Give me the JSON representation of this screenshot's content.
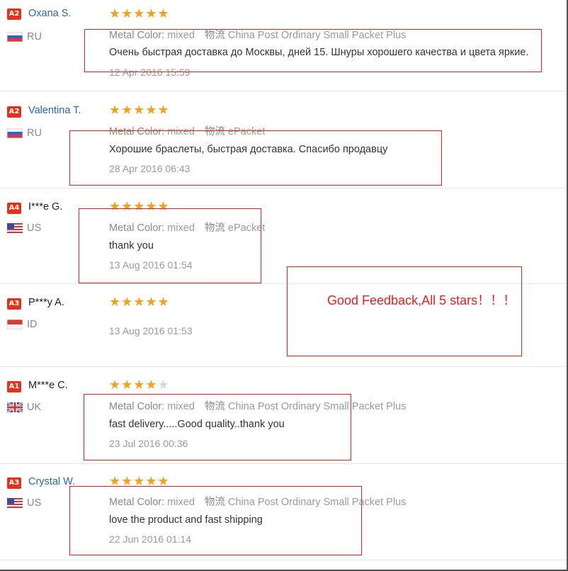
{
  "labels": {
    "metal_color": "Metal Color:",
    "logistics": "物流"
  },
  "reviews": [
    {
      "badge": "A2",
      "name": "Oxana S.",
      "country": "RU",
      "stars": "★★★★★",
      "stars_off": "",
      "rating": 5,
      "metal": "mixed",
      "shipping": "China Post Ordinary Small Packet Plus",
      "text": "Очень быстрая доставка до Москвы, дней 15. Шнуры хорошего качества и цвета яркие.",
      "date": "12 Apr 2016 15:59"
    },
    {
      "badge": "A2",
      "name": "Valentina T.",
      "country": "RU",
      "stars": "★★★★★",
      "stars_off": "",
      "rating": 5,
      "metal": "mixed",
      "shipping": "ePacket",
      "text": "Хорошие браслеты, быстрая доставка. Спасибо продавцу",
      "date": "28 Apr 2016 06:43"
    },
    {
      "badge": "A4",
      "name": "I***e G.",
      "country": "US",
      "stars": "★★★★★",
      "stars_off": "",
      "rating": 5,
      "metal": "mixed",
      "shipping": "ePacket",
      "text": "thank you",
      "date": "13 Aug 2016 01:54"
    },
    {
      "badge": "A3",
      "name": "P***y A.",
      "country": "ID",
      "stars": "★★★★★",
      "stars_off": "",
      "rating": 5,
      "date": "13 Aug 2016 01:53"
    },
    {
      "badge": "A1",
      "name": "M***e C.",
      "country": "UK",
      "stars": "★★★★",
      "stars_off": "★",
      "rating": 4,
      "metal": "mixed",
      "shipping": "China Post Ordinary Small Packet Plus",
      "text": "fast delivery.....Good quality..thank you",
      "date": "23 Jul 2016 00:36"
    },
    {
      "badge": "A3",
      "name": "Crystal W.",
      "country": "US",
      "stars": "★★★★★",
      "stars_off": "",
      "rating": 5,
      "metal": "mixed",
      "shipping": "China Post Ordinary Small Packet Plus",
      "text": "love the product and fast shipping",
      "date": "22 Jun 2016 01:14"
    }
  ],
  "note": {
    "text": "Good Feedback,All 5 stars！！！",
    "color": "#e52020"
  },
  "colors": {
    "badge": "#e3321b",
    "star": "#f4a11f",
    "link": "#2b64b5",
    "highlight_border": "#dd2222"
  }
}
